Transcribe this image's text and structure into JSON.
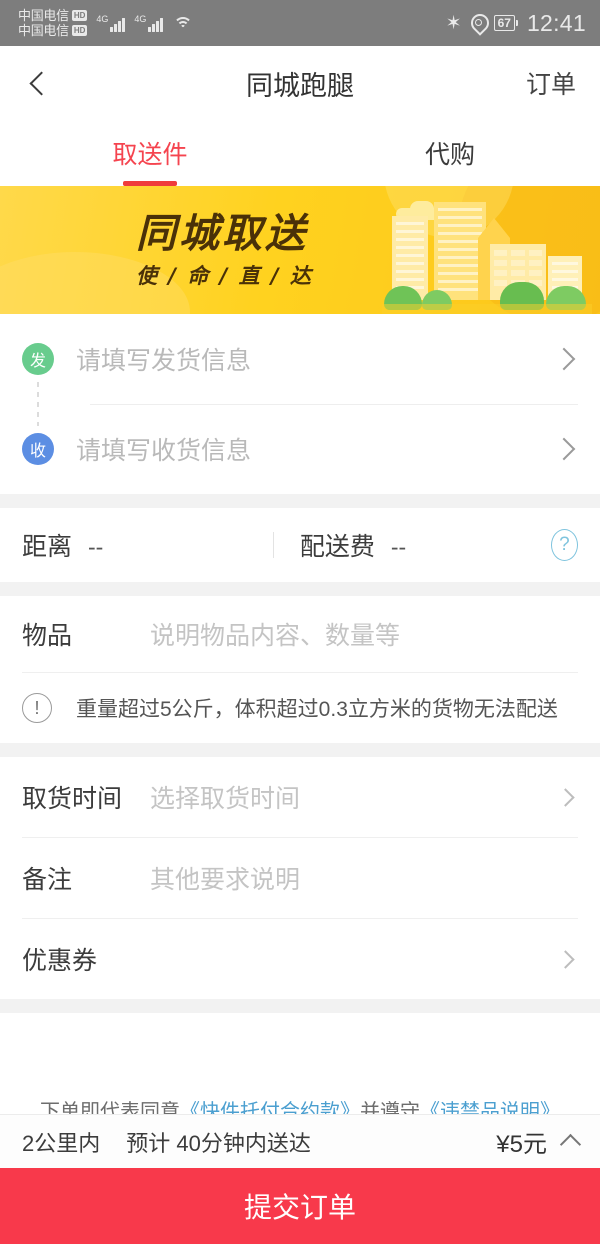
{
  "status_bar": {
    "carrier": "中国电信",
    "hd_badge": "HD",
    "network": "4G",
    "bluetooth_icon": "bluetooth-icon",
    "location_icon": "location-pin-icon",
    "wifi_icon": "wifi-icon",
    "battery_level": "67",
    "time": "12:41"
  },
  "header": {
    "back_icon": "back-chevron-icon",
    "title": "同城跑腿",
    "right_action": "订单"
  },
  "tabs": [
    {
      "label": "取送件",
      "active": true
    },
    {
      "label": "代购",
      "active": false
    }
  ],
  "banner": {
    "title": "同城取送",
    "subtitle": "使 / 命 / 直 / 达",
    "bg_color": "#ffd21f",
    "text_color": "#4a3108"
  },
  "address": {
    "send": {
      "badge": "发",
      "badge_color": "#68cc8d",
      "placeholder": "请填写发货信息"
    },
    "receive": {
      "badge": "收",
      "badge_color": "#5c8ee3",
      "placeholder": "请填写收货信息"
    }
  },
  "distance_fee": {
    "distance_label": "距离",
    "distance_value": "--",
    "fee_label": "配送费",
    "fee_value": "--",
    "help_icon": "question-mark-icon"
  },
  "item": {
    "label": "物品",
    "placeholder": "说明物品内容、数量等",
    "warning_icon": "exclamation-icon",
    "warning_text": "重量超过5公斤，体积超过0.3立方米的货物无法配送"
  },
  "form_rows": [
    {
      "label": "取货时间",
      "placeholder": "选择取货时间",
      "chevron": true
    },
    {
      "label": "备注",
      "placeholder": "其他要求说明",
      "chevron": false
    },
    {
      "label": "优惠券",
      "placeholder": "",
      "chevron": true
    }
  ],
  "terms": {
    "prefix": "下单即代表同意",
    "link1": "《快件托付合约款》",
    "middle": "并遵守",
    "link2": "《违禁品说明》",
    "link_color": "#4b9fd0"
  },
  "summary": {
    "distance_text": "2公里内",
    "eta_text": "预计 40分钟内送达",
    "price": "¥5元",
    "expand_icon": "chevron-up-icon"
  },
  "submit": {
    "label": "提交订单",
    "color": "#f8394b"
  }
}
